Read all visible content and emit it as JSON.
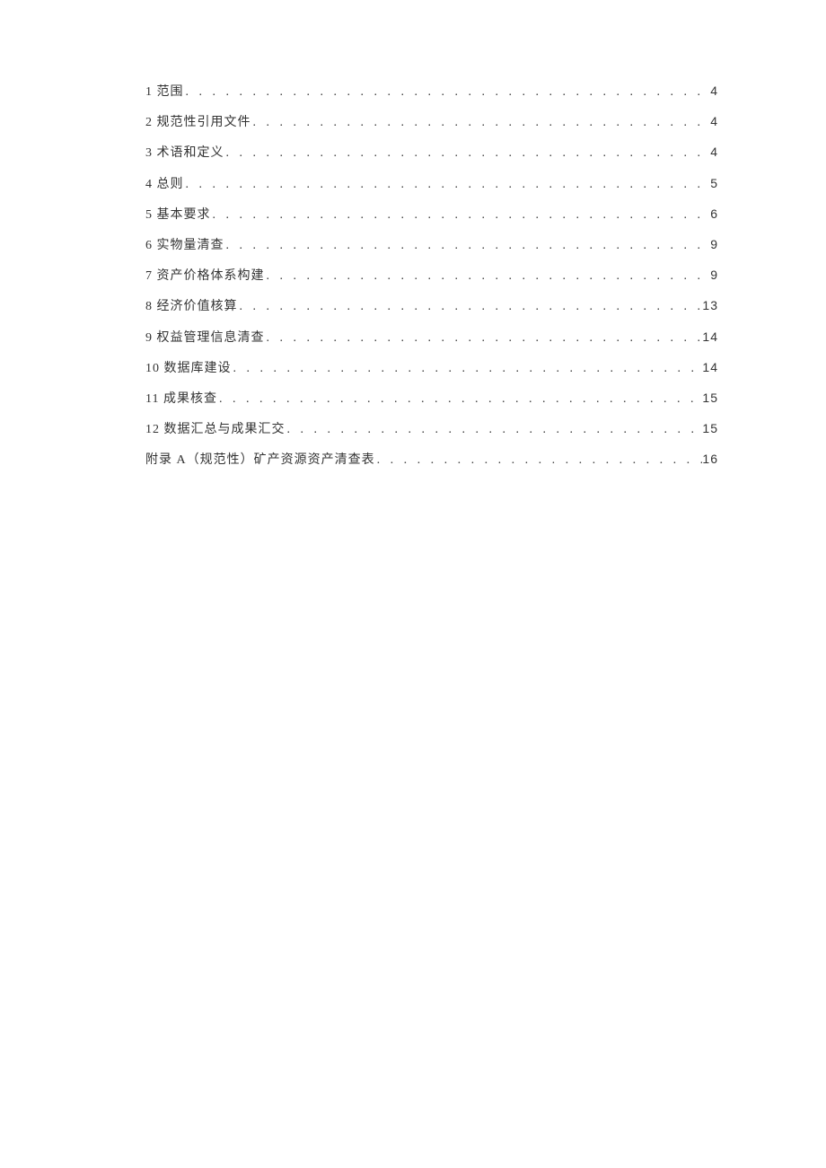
{
  "toc": [
    {
      "title": "1 范围",
      "page": "4"
    },
    {
      "title": "2 规范性引用文件",
      "page": "4"
    },
    {
      "title": "3 术语和定义",
      "page": "4"
    },
    {
      "title": "4 总则",
      "page": "5"
    },
    {
      "title": "5 基本要求",
      "page": "6"
    },
    {
      "title": "6 实物量清查",
      "page": "9"
    },
    {
      "title": "7 资产价格体系构建",
      "page": "9"
    },
    {
      "title": "8 经济价值核算",
      "page": "13"
    },
    {
      "title": "9 权益管理信息清查",
      "page": "14"
    },
    {
      "title": "10 数据库建设",
      "page": "14"
    },
    {
      "title": "11 成果核查",
      "page": "15"
    },
    {
      "title": "12 数据汇总与成果汇交",
      "page": "15"
    },
    {
      "title": "附录 A（规范性）矿产资源资产清查表",
      "page": "16"
    }
  ]
}
